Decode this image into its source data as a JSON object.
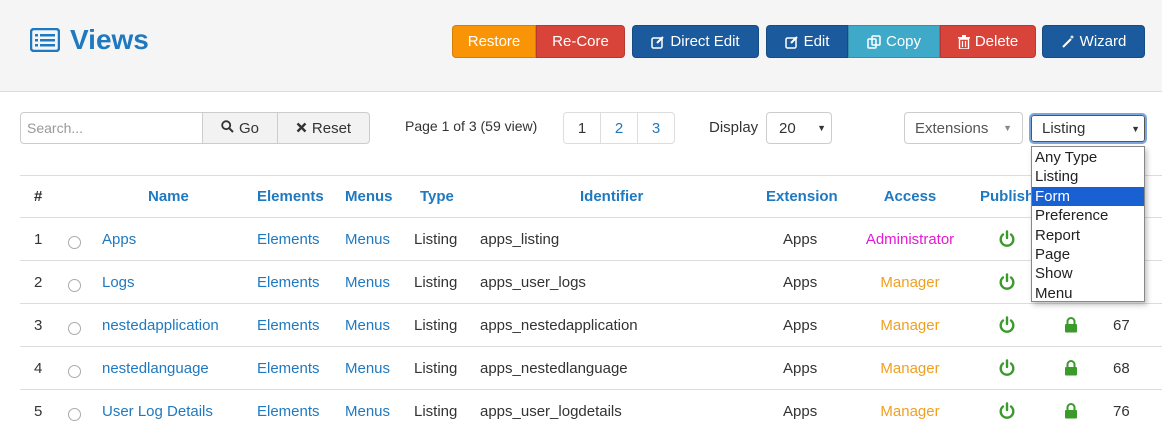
{
  "header": {
    "title": "Views",
    "title_icon": "list-icon",
    "buttons": {
      "restore": "Restore",
      "recore": "Re-Core",
      "direct_edit": "Direct Edit",
      "edit": "Edit",
      "copy": "Copy",
      "delete": "Delete",
      "wizard": "Wizard"
    }
  },
  "toolbar": {
    "search_placeholder": "Search...",
    "go_label": "Go",
    "reset_label": "Reset",
    "page_info": "Page 1 of 3 (59 view)",
    "pages": [
      "1",
      "2",
      "3"
    ],
    "display_label": "Display",
    "display_value": "20",
    "extensions_value": "Extensions",
    "type_value": "Listing",
    "type_options": [
      "Any Type",
      "Listing",
      "Form",
      "Preference",
      "Report",
      "Page",
      "Show",
      "Menu"
    ],
    "type_highlighted": "Form"
  },
  "table": {
    "headers": {
      "num": "#",
      "name": "Name",
      "elements": "Elements",
      "menus": "Menus",
      "type": "Type",
      "identifier": "Identifier",
      "extension": "Extension",
      "access": "Access",
      "published": "Published"
    },
    "rows": [
      {
        "num": "1",
        "name": "Apps",
        "elements": "Elements",
        "menus": "Menus",
        "type": "Listing",
        "identifier": "apps_listing",
        "extension": "Apps",
        "access": "Administrator",
        "id": ""
      },
      {
        "num": "2",
        "name": "Logs",
        "elements": "Elements",
        "menus": "Menus",
        "type": "Listing",
        "identifier": "apps_user_logs",
        "extension": "Apps",
        "access": "Manager",
        "id": ""
      },
      {
        "num": "3",
        "name": "nestedapplication",
        "elements": "Elements",
        "menus": "Menus",
        "type": "Listing",
        "identifier": "apps_nestedapplication",
        "extension": "Apps",
        "access": "Manager",
        "id": "67"
      },
      {
        "num": "4",
        "name": "nestedlanguage",
        "elements": "Elements",
        "menus": "Menus",
        "type": "Listing",
        "identifier": "apps_nestedlanguage",
        "extension": "Apps",
        "access": "Manager",
        "id": "68"
      },
      {
        "num": "5",
        "name": "User Log Details",
        "elements": "Elements",
        "menus": "Menus",
        "type": "Listing",
        "identifier": "apps_user_logdetails",
        "extension": "Apps",
        "access": "Manager",
        "id": "76"
      }
    ]
  },
  "colors": {
    "link": "#1f79c0",
    "administrator": "#e619d4",
    "manager": "#f0a020",
    "published": "#3a9a2a",
    "lock": "#3a9a2a"
  }
}
